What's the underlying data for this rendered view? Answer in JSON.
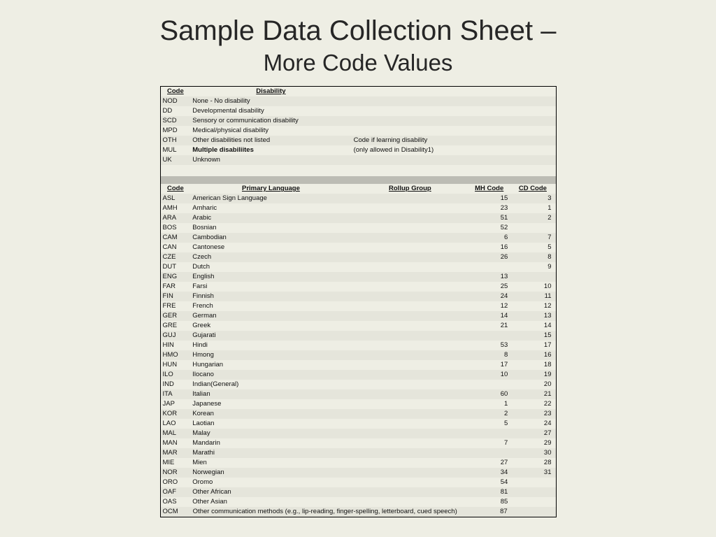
{
  "title": {
    "line1": "Sample Data Collection Sheet –",
    "line2": "More Code Values"
  },
  "disability_section": {
    "headers": {
      "code": "Code",
      "label": "Disability"
    },
    "rows": [
      {
        "code": "NOD",
        "label": "None - No disability",
        "note": ""
      },
      {
        "code": "DD",
        "label": "Developmental disability",
        "note": ""
      },
      {
        "code": "SCD",
        "label": "Sensory or communication disability",
        "note": ""
      },
      {
        "code": "MPD",
        "label": "Medical/physical disability",
        "note": ""
      },
      {
        "code": "OTH",
        "label": "Other disabilities not listed",
        "note": "Code if learning disability"
      },
      {
        "code": "MUL",
        "label": "Multiple disabiliites",
        "note": "(only allowed in Disability1)",
        "bold": true
      },
      {
        "code": "UK",
        "label": "Unknown",
        "note": ""
      }
    ]
  },
  "language_section": {
    "headers": {
      "code": "Code",
      "label": "Primary Language",
      "rollup": "Rollup Group",
      "mh": "MH Code",
      "cd": "CD Code"
    },
    "rows": [
      {
        "code": "ASL",
        "label": "American Sign Language",
        "mh": "15",
        "cd": "3"
      },
      {
        "code": "AMH",
        "label": "Amharic",
        "mh": "23",
        "cd": "1"
      },
      {
        "code": "ARA",
        "label": "Arabic",
        "mh": "51",
        "cd": "2"
      },
      {
        "code": "BOS",
        "label": "Bosnian",
        "mh": "52",
        "cd": ""
      },
      {
        "code": "CAM",
        "label": "Cambodian",
        "mh": "6",
        "cd": "7"
      },
      {
        "code": "CAN",
        "label": "Cantonese",
        "mh": "16",
        "cd": "5"
      },
      {
        "code": "CZE",
        "label": "Czech",
        "mh": "26",
        "cd": "8"
      },
      {
        "code": "DUT",
        "label": "Dutch",
        "mh": "",
        "cd": "9"
      },
      {
        "code": "ENG",
        "label": "English",
        "mh": "13",
        "cd": ""
      },
      {
        "code": "FAR",
        "label": "Farsi",
        "mh": "25",
        "cd": "10"
      },
      {
        "code": "FIN",
        "label": "Finnish",
        "mh": "24",
        "cd": "11"
      },
      {
        "code": "FRE",
        "label": "French",
        "mh": "12",
        "cd": "12"
      },
      {
        "code": "GER",
        "label": "German",
        "mh": "14",
        "cd": "13"
      },
      {
        "code": "GRE",
        "label": "Greek",
        "mh": "21",
        "cd": "14"
      },
      {
        "code": "GUJ",
        "label": "Gujarati",
        "mh": "",
        "cd": "15"
      },
      {
        "code": "HIN",
        "label": "Hindi",
        "mh": "53",
        "cd": "17"
      },
      {
        "code": "HMO",
        "label": "Hmong",
        "mh": "8",
        "cd": "16"
      },
      {
        "code": "HUN",
        "label": "Hungarian",
        "mh": "17",
        "cd": "18"
      },
      {
        "code": "ILO",
        "label": "Ilocano",
        "mh": "10",
        "cd": "19"
      },
      {
        "code": "IND",
        "label": "Indian(General)",
        "mh": "",
        "cd": "20"
      },
      {
        "code": "ITA",
        "label": "Italian",
        "mh": "60",
        "cd": "21"
      },
      {
        "code": "JAP",
        "label": "Japanese",
        "mh": "1",
        "cd": "22"
      },
      {
        "code": "KOR",
        "label": "Korean",
        "mh": "2",
        "cd": "23"
      },
      {
        "code": "LAO",
        "label": "Laotian",
        "mh": "5",
        "cd": "24"
      },
      {
        "code": "MAL",
        "label": "Malay",
        "mh": "",
        "cd": "27"
      },
      {
        "code": "MAN",
        "label": "Mandarin",
        "mh": "7",
        "cd": "29"
      },
      {
        "code": "MAR",
        "label": "Marathi",
        "mh": "",
        "cd": "30"
      },
      {
        "code": "MIE",
        "label": "Mien",
        "mh": "27",
        "cd": "28"
      },
      {
        "code": "NOR",
        "label": "Norwegian",
        "mh": "34",
        "cd": "31"
      },
      {
        "code": "ORO",
        "label": "Oromo",
        "mh": "54",
        "cd": ""
      },
      {
        "code": "OAF",
        "label": "Other African",
        "mh": "81",
        "cd": ""
      },
      {
        "code": "OAS",
        "label": "Other Asian",
        "mh": "85",
        "cd": ""
      },
      {
        "code": "OCM",
        "label": "Other communication methods (e.g., lip-reading, finger-spelling, letterboard, cued speech)",
        "mh": "87",
        "cd": ""
      }
    ]
  }
}
